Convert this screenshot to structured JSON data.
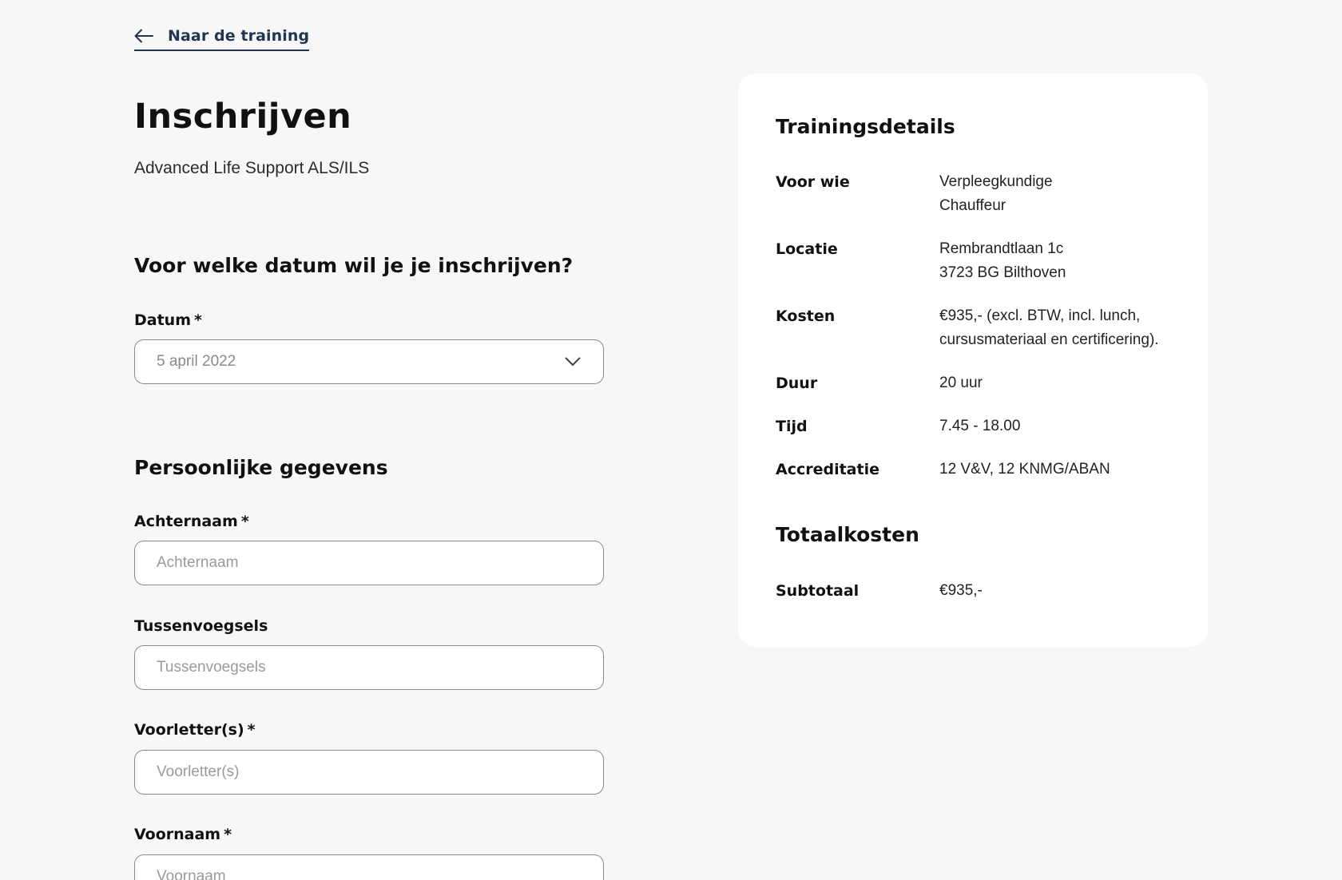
{
  "back_link": {
    "label": "Naar de training",
    "icon": "arrow-left-icon"
  },
  "header": {
    "title": "Inschrijven",
    "subtitle": "Advanced Life Support ALS/ILS"
  },
  "date_section": {
    "title": "Voor welke datum wil je je inschrijven?",
    "date_field": {
      "label": "Datum",
      "required_marker": "*",
      "selected_value": "5 april 2022",
      "icon": "chevron-down-icon"
    }
  },
  "personal_section": {
    "title": "Persoonlijke gegevens",
    "fields": {
      "lastname": {
        "label": "Achternaam",
        "required_marker": "*",
        "placeholder": "Achternaam"
      },
      "infix": {
        "label": "Tussenvoegsels",
        "required_marker": "",
        "placeholder": "Tussenvoegsels"
      },
      "initials": {
        "label": "Voorletter(s)",
        "required_marker": "*",
        "placeholder": "Voorletter(s)"
      },
      "firstname": {
        "label": "Voornaam",
        "required_marker": "*",
        "placeholder": "Voornaam"
      }
    }
  },
  "training_details": {
    "title": "Trainingsdetails",
    "rows": [
      {
        "key": "Voor wie",
        "lines": [
          "Verpleegkundige",
          "Chauffeur"
        ]
      },
      {
        "key": "Locatie",
        "lines": [
          "Rembrandtlaan 1c",
          "3723 BG Bilthoven"
        ]
      },
      {
        "key": "Kosten",
        "lines": [
          "€935,-  (excl. BTW, incl. lunch,",
          "cursusmateriaal en certificering)."
        ]
      },
      {
        "key": "Duur",
        "lines": [
          "20 uur"
        ]
      },
      {
        "key": "Tijd",
        "lines": [
          "7.45 - 18.00"
        ]
      },
      {
        "key": "Accreditatie",
        "lines": [
          "12 V&V, 12 KNMG/ABAN"
        ]
      }
    ]
  },
  "total_costs": {
    "title": "Totaalkosten",
    "subtotal_label": "Subtotaal",
    "subtotal_value": "€935,-"
  },
  "colors": {
    "background": "#f7f7f7",
    "card": "#ffffff",
    "link": "#1f3550",
    "input_border": "#8a8a8a",
    "placeholder": "#9a9a9a"
  }
}
